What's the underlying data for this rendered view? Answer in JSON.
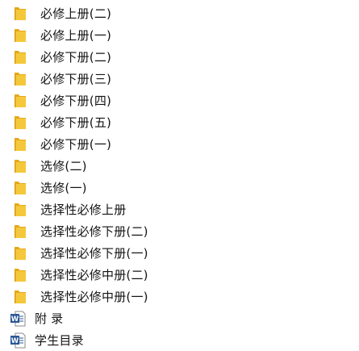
{
  "explorer": {
    "items": [
      {
        "label": "必修上册(二)",
        "type": "folder",
        "icon": "folder-icon"
      },
      {
        "label": "必修上册(一)",
        "type": "folder",
        "icon": "folder-icon"
      },
      {
        "label": "必修下册(二)",
        "type": "folder",
        "icon": "folder-icon"
      },
      {
        "label": "必修下册(三)",
        "type": "folder",
        "icon": "folder-icon"
      },
      {
        "label": "必修下册(四)",
        "type": "folder",
        "icon": "folder-icon"
      },
      {
        "label": "必修下册(五)",
        "type": "folder",
        "icon": "folder-icon"
      },
      {
        "label": "必修下册(一)",
        "type": "folder",
        "icon": "folder-icon"
      },
      {
        "label": "选修(二)",
        "type": "folder",
        "icon": "folder-icon"
      },
      {
        "label": "选修(一)",
        "type": "folder",
        "icon": "folder-icon"
      },
      {
        "label": "选择性必修上册",
        "type": "folder",
        "icon": "folder-icon"
      },
      {
        "label": "选择性必修下册(二)",
        "type": "folder",
        "icon": "folder-icon"
      },
      {
        "label": "选择性必修下册(一)",
        "type": "folder",
        "icon": "folder-icon"
      },
      {
        "label": "选择性必修中册(二)",
        "type": "folder",
        "icon": "folder-icon"
      },
      {
        "label": "选择性必修中册(一)",
        "type": "folder",
        "icon": "folder-icon"
      },
      {
        "label": "附  录",
        "type": "document",
        "icon": "word-document-icon"
      },
      {
        "label": "学生目录",
        "type": "document",
        "icon": "word-document-icon"
      }
    ]
  },
  "colors": {
    "folder_body": "#f5c83b",
    "folder_back": "#e6a817",
    "folder_edge": "#d69a10",
    "word_blue": "#2b5797",
    "doc_page": "#ffffff",
    "doc_border": "#8a8a8a"
  }
}
